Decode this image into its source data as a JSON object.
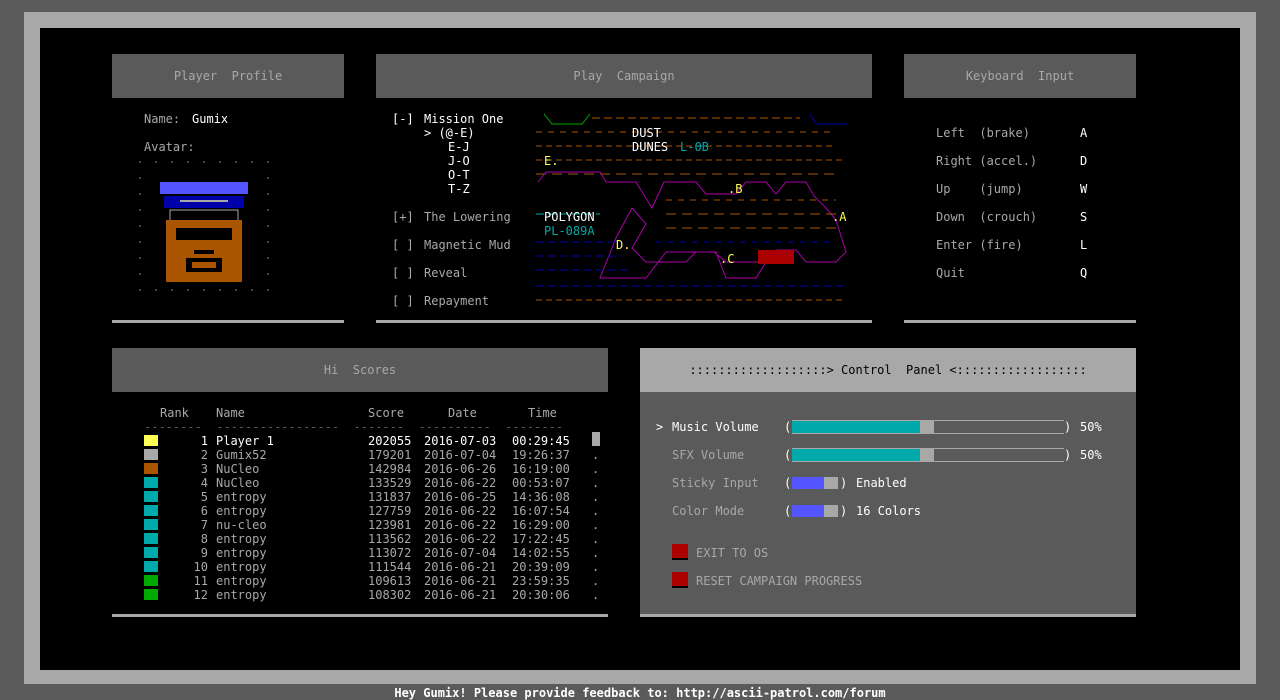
{
  "footer": "Hey Gumix! Please provide feedback to: http://ascii-patrol.com/forum",
  "colors": {
    "yellow": "#ffff55",
    "cyan": "#00aaaa",
    "blue": "#5555ff",
    "magenta": "#aa00aa",
    "brown": "#aa5500",
    "red": "#aa0000",
    "green": "#00aa00",
    "gray": "#a8a8a8",
    "white": "#ffffff"
  },
  "profile": {
    "header": "Player  Profile",
    "name_label": "Name:",
    "name_value": "Gumix",
    "avatar_label": "Avatar:"
  },
  "campaign": {
    "header": "Play  Campaign",
    "missions": [
      {
        "check": "[-]",
        "name": "Mission One"
      },
      {
        "check": "[+]",
        "name": "The Lowering"
      },
      {
        "check": "[ ]",
        "name": "Magnetic Mud"
      },
      {
        "check": "[ ]",
        "name": "Reveal"
      },
      {
        "check": "[ ]",
        "name": "Repayment"
      }
    ],
    "sections": [
      {
        "label": "> (@-E)"
      },
      {
        "label": "E-J"
      },
      {
        "label": "J-O"
      },
      {
        "label": "O-T"
      },
      {
        "label": "T-Z"
      }
    ],
    "map_labels": {
      "dust": "DUST",
      "dunes": "DUNES",
      "l0b": "L-0B",
      "polygon": "POLYGON",
      "pl089a": "PL-089A",
      "e": "E.",
      "d": "D.",
      "c": ".C",
      "b": ".B",
      "a": ".A"
    }
  },
  "keyboard": {
    "header": "Keyboard  Input",
    "bindings": [
      {
        "action": "Left  (brake)",
        "key": "A"
      },
      {
        "action": "Right (accel.)",
        "key": "D"
      },
      {
        "action": "Up    (jump)",
        "key": "W"
      },
      {
        "action": "Down  (crouch)",
        "key": "S"
      },
      {
        "action": "Enter (fire)",
        "key": "L"
      },
      {
        "action": "Quit",
        "key": "Q"
      }
    ]
  },
  "scores": {
    "header": "Hi  Scores",
    "columns": [
      "Rank",
      "Name",
      "Score",
      "Date",
      "Time"
    ],
    "rows": [
      {
        "color": "#ffff55",
        "rank": "1",
        "name": "Player 1",
        "score": "202055",
        "date": "2016-07-03",
        "time": "00:29:45",
        "highlight": true
      },
      {
        "color": "#a8a8a8",
        "rank": "2",
        "name": "Gumix52",
        "score": "179201",
        "date": "2016-07-04",
        "time": "19:26:37"
      },
      {
        "color": "#aa5500",
        "rank": "3",
        "name": "NuCleo",
        "score": "142984",
        "date": "2016-06-26",
        "time": "16:19:00"
      },
      {
        "color": "#00aaaa",
        "rank": "4",
        "name": "NuCleo",
        "score": "133529",
        "date": "2016-06-22",
        "time": "00:53:07"
      },
      {
        "color": "#00aaaa",
        "rank": "5",
        "name": "entropy",
        "score": "131837",
        "date": "2016-06-25",
        "time": "14:36:08"
      },
      {
        "color": "#00aaaa",
        "rank": "6",
        "name": "entropy",
        "score": "127759",
        "date": "2016-06-22",
        "time": "16:07:54"
      },
      {
        "color": "#00aaaa",
        "rank": "7",
        "name": "nu-cleo",
        "score": "123981",
        "date": "2016-06-22",
        "time": "16:29:00"
      },
      {
        "color": "#00aaaa",
        "rank": "8",
        "name": "entropy",
        "score": "113562",
        "date": "2016-06-22",
        "time": "17:22:45"
      },
      {
        "color": "#00aaaa",
        "rank": "9",
        "name": "entropy",
        "score": "113072",
        "date": "2016-07-04",
        "time": "14:02:55"
      },
      {
        "color": "#00aaaa",
        "rank": "10",
        "name": "entropy",
        "score": "111544",
        "date": "2016-06-21",
        "time": "20:39:09"
      },
      {
        "color": "#00aa00",
        "rank": "11",
        "name": "entropy",
        "score": "109613",
        "date": "2016-06-21",
        "time": "23:59:35"
      },
      {
        "color": "#00aa00",
        "rank": "12",
        "name": "entropy",
        "score": "108302",
        "date": "2016-06-21",
        "time": "20:30:06"
      }
    ]
  },
  "control": {
    "header": ":::::::::::::::::::> Control  Panel <::::::::::::::::::",
    "settings": [
      {
        "label": "Music Volume",
        "value": "50%",
        "level": 0.5,
        "selected": true
      },
      {
        "label": "SFX Volume",
        "value": "50%",
        "level": 0.5
      },
      {
        "label": "Sticky Input",
        "value": "Enabled"
      },
      {
        "label": "Color Mode",
        "value": "16 Colors"
      }
    ],
    "actions": [
      {
        "label": "EXIT TO OS"
      },
      {
        "label": "RESET CAMPAIGN PROGRESS"
      }
    ]
  }
}
